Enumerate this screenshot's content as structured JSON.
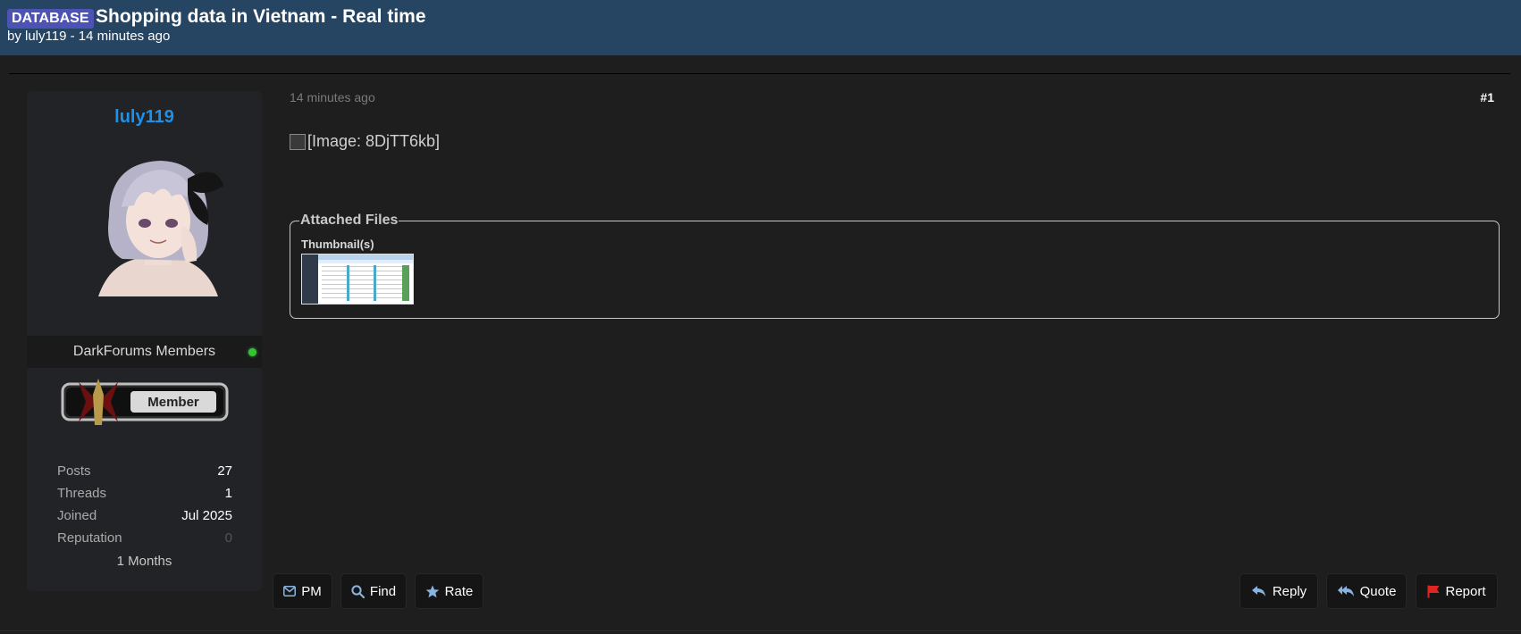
{
  "thread": {
    "prefix": "DATABASE",
    "title": "Shopping data in Vietnam - Real time",
    "byline": "by luly119 - 14 minutes ago"
  },
  "author": {
    "username": "luly119",
    "usergroup": "DarkForums Members",
    "online": true,
    "rank_badge": "Member",
    "stats": [
      {
        "label": "Posts",
        "value": "27"
      },
      {
        "label": "Threads",
        "value": "1"
      },
      {
        "label": "Joined",
        "value": "Jul 2025"
      },
      {
        "label": "Reputation",
        "value": "0"
      }
    ],
    "membership": "1 Months"
  },
  "post": {
    "time": "14 minutes ago",
    "number": "#1",
    "image_alt": "[Image: 8DjTT6kb]",
    "attachments": {
      "legend": "Attached Files",
      "thumbnails_label": "Thumbnail(s)"
    }
  },
  "buttons": {
    "pm": "PM",
    "find": "Find",
    "rate": "Rate",
    "reply": "Reply",
    "quote": "Quote",
    "report": "Report"
  },
  "colors": {
    "header_bg": "#264563",
    "prefix_bg": "#4d52b5",
    "username": "#1e90e8",
    "online": "#35c435",
    "report_flag": "#e02424"
  },
  "icons": [
    "mail-icon",
    "search-icon",
    "star-icon",
    "reply-icon",
    "quote-icon",
    "flag-icon"
  ]
}
